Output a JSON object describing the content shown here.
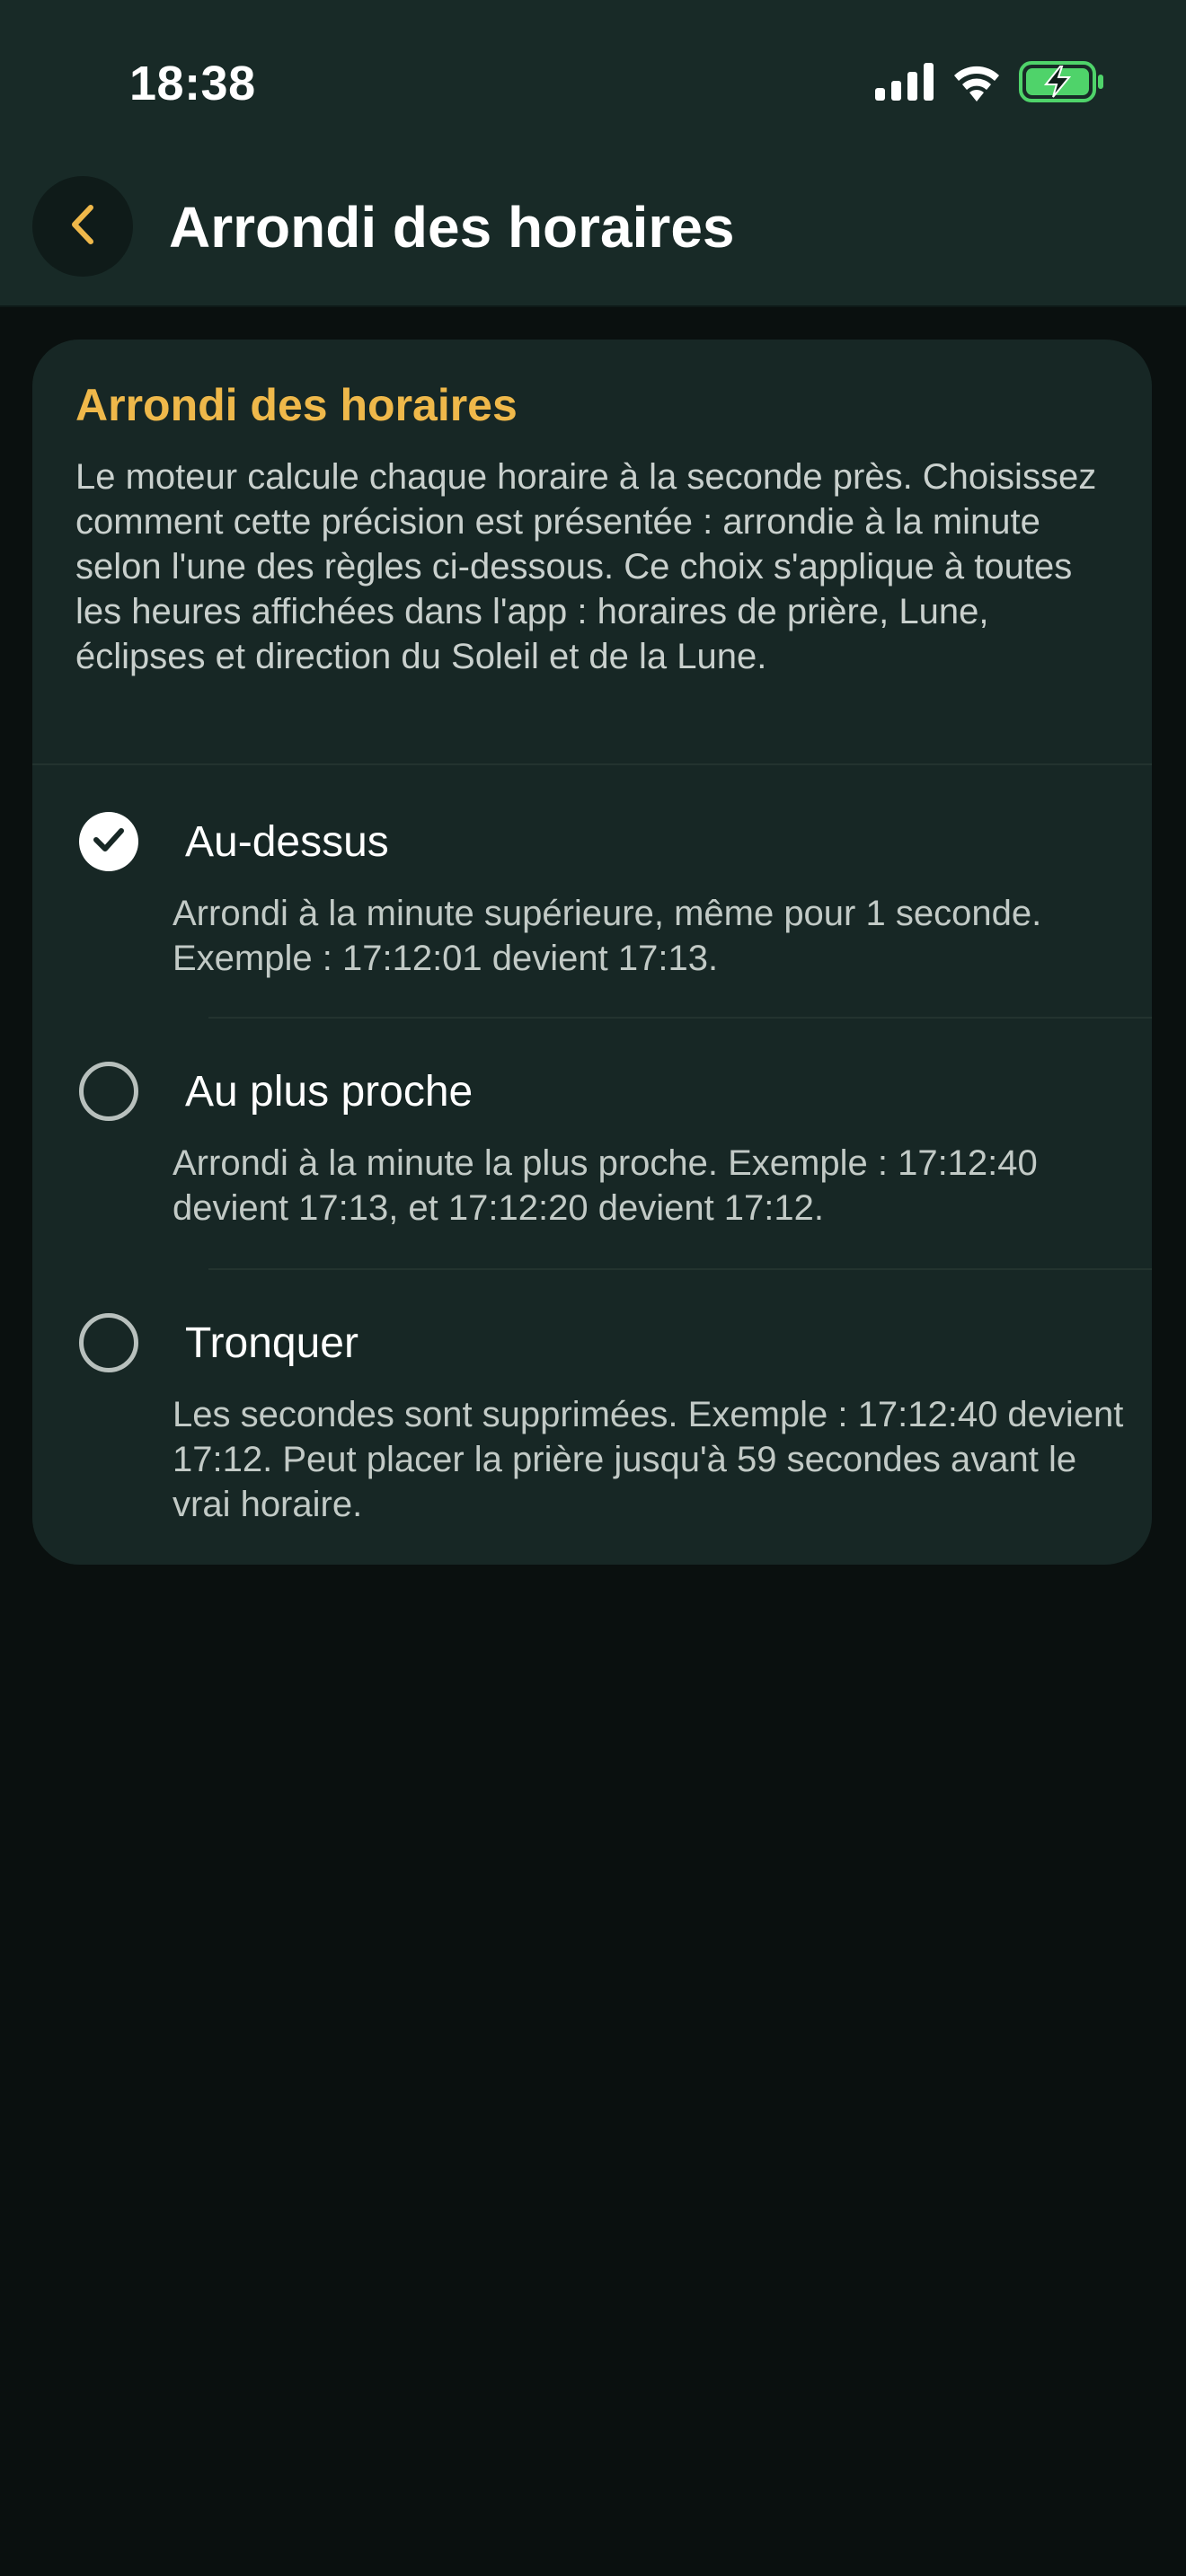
{
  "status_bar": {
    "time": "18:38",
    "icons": [
      "cellular-signal-icon",
      "wifi-icon",
      "battery-charging-icon"
    ],
    "battery_color": "#4fd36a"
  },
  "header": {
    "title": "Arrondi des horaires",
    "back_icon": "chevron-left-icon"
  },
  "card": {
    "title": "Arrondi des horaires",
    "description": "Le moteur calcule chaque horaire à la seconde près. Choisissez comment cette précision est présentée : arrondie à la minute selon l'une des règles ci-dessous. Ce choix s'applique à toutes les heures affichées dans l'app : horaires de prière, Lune, éclipses et direction du Soleil et de la Lune.",
    "options": [
      {
        "label": "Au-dessus",
        "description": "Arrondi à la minute supérieure, même pour 1 seconde. Exemple : 17:12:01 devient 17:13.",
        "selected": true
      },
      {
        "label": "Au plus proche",
        "description": "Arrondi à la minute la plus proche. Exemple : 17:12:40 devient 17:13, et 17:12:20 devient 17:12.",
        "selected": false
      },
      {
        "label": "Tronquer",
        "description": "Les secondes sont supprimées. Exemple : 17:12:40 devient 17:12. Peut placer la prière jusqu'à 59 secondes avant le vrai horaire.",
        "selected": false
      }
    ]
  },
  "colors": {
    "accent": "#efb84a",
    "header_bg": "#182a27",
    "card_bg": "#172725",
    "page_bg": "#0a100f"
  }
}
